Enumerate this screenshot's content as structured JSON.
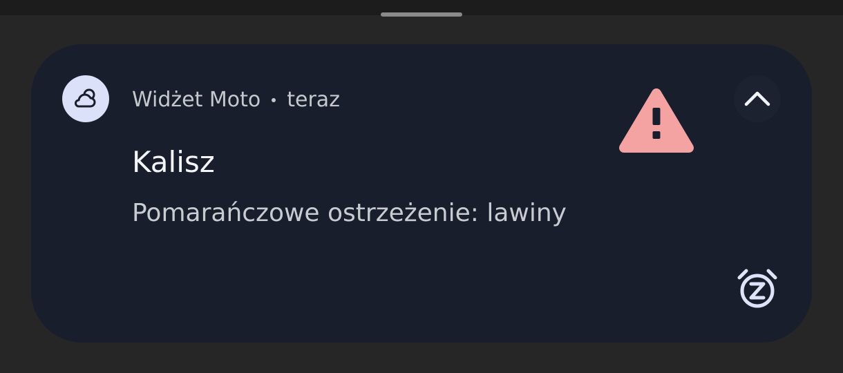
{
  "notification": {
    "app_name": "Widżet Moto",
    "time": "teraz",
    "title": "Kalisz",
    "body": "Pomarańczowe ostrzeżenie: lawiny",
    "icons": {
      "app": "cloud-icon",
      "warning": "warning-icon",
      "expand": "chevron-up-icon",
      "snooze": "snooze-alarm-icon"
    },
    "colors": {
      "card_background": "#181e2b",
      "app_icon_background": "#dbe1f8",
      "warning": "#f4a3a2",
      "snooze": "#dfe4fb"
    }
  }
}
